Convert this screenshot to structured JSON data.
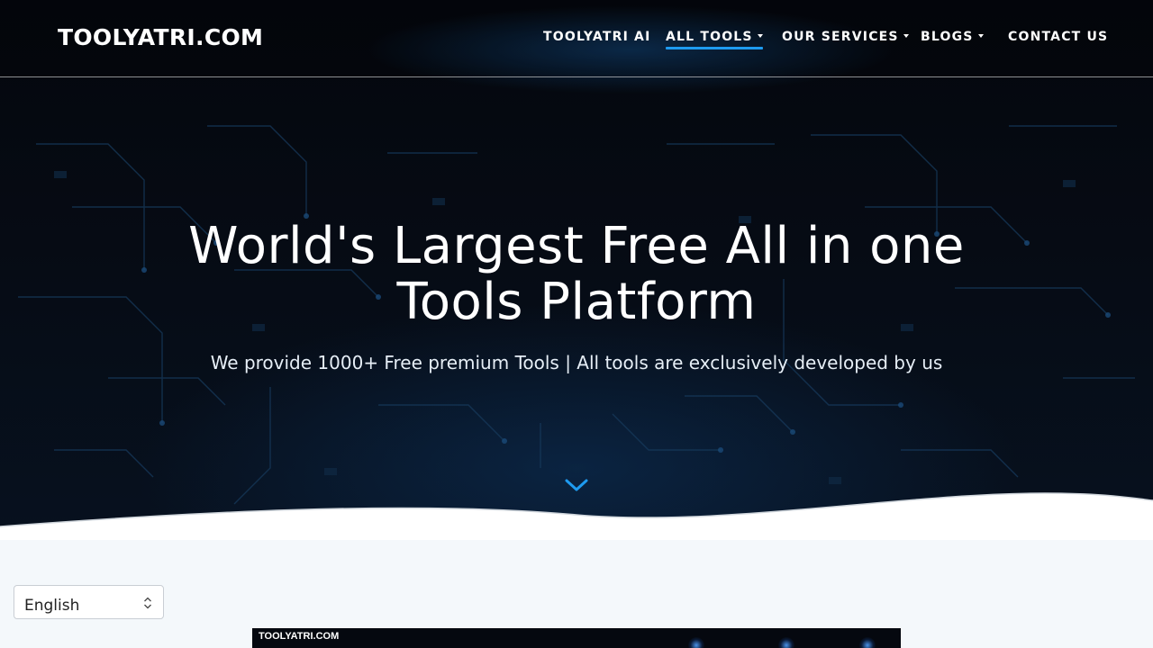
{
  "site": {
    "logo": "TOOLYATRI.COM"
  },
  "nav": {
    "items": [
      {
        "label": "TOOLYATRI AI",
        "dropdown": false,
        "active": false
      },
      {
        "label": "ALL TOOLS",
        "dropdown": true,
        "active": true
      },
      {
        "label": "OUR SERVICES",
        "dropdown": true,
        "active": false
      },
      {
        "label": "BLOGS",
        "dropdown": true,
        "active": false
      },
      {
        "label": "CONTACT US",
        "dropdown": false,
        "active": false
      }
    ]
  },
  "hero": {
    "headline_line1": "World's Largest Free All in one",
    "headline_line2": "Tools Platform",
    "subtitle": "We provide 1000+ Free premium Tools | All tools are exclusively developed by us",
    "scroll_icon": "chevron-down-icon"
  },
  "language_select": {
    "value": "English",
    "icon": "updown-chevron-icon"
  },
  "preview": {
    "label": "TOOLYATRI.COM"
  },
  "colors": {
    "accent": "#1e9bf0",
    "hero_bg": "#060b14",
    "page_bg": "#f4f8fb",
    "text_light": "#ffffff"
  }
}
